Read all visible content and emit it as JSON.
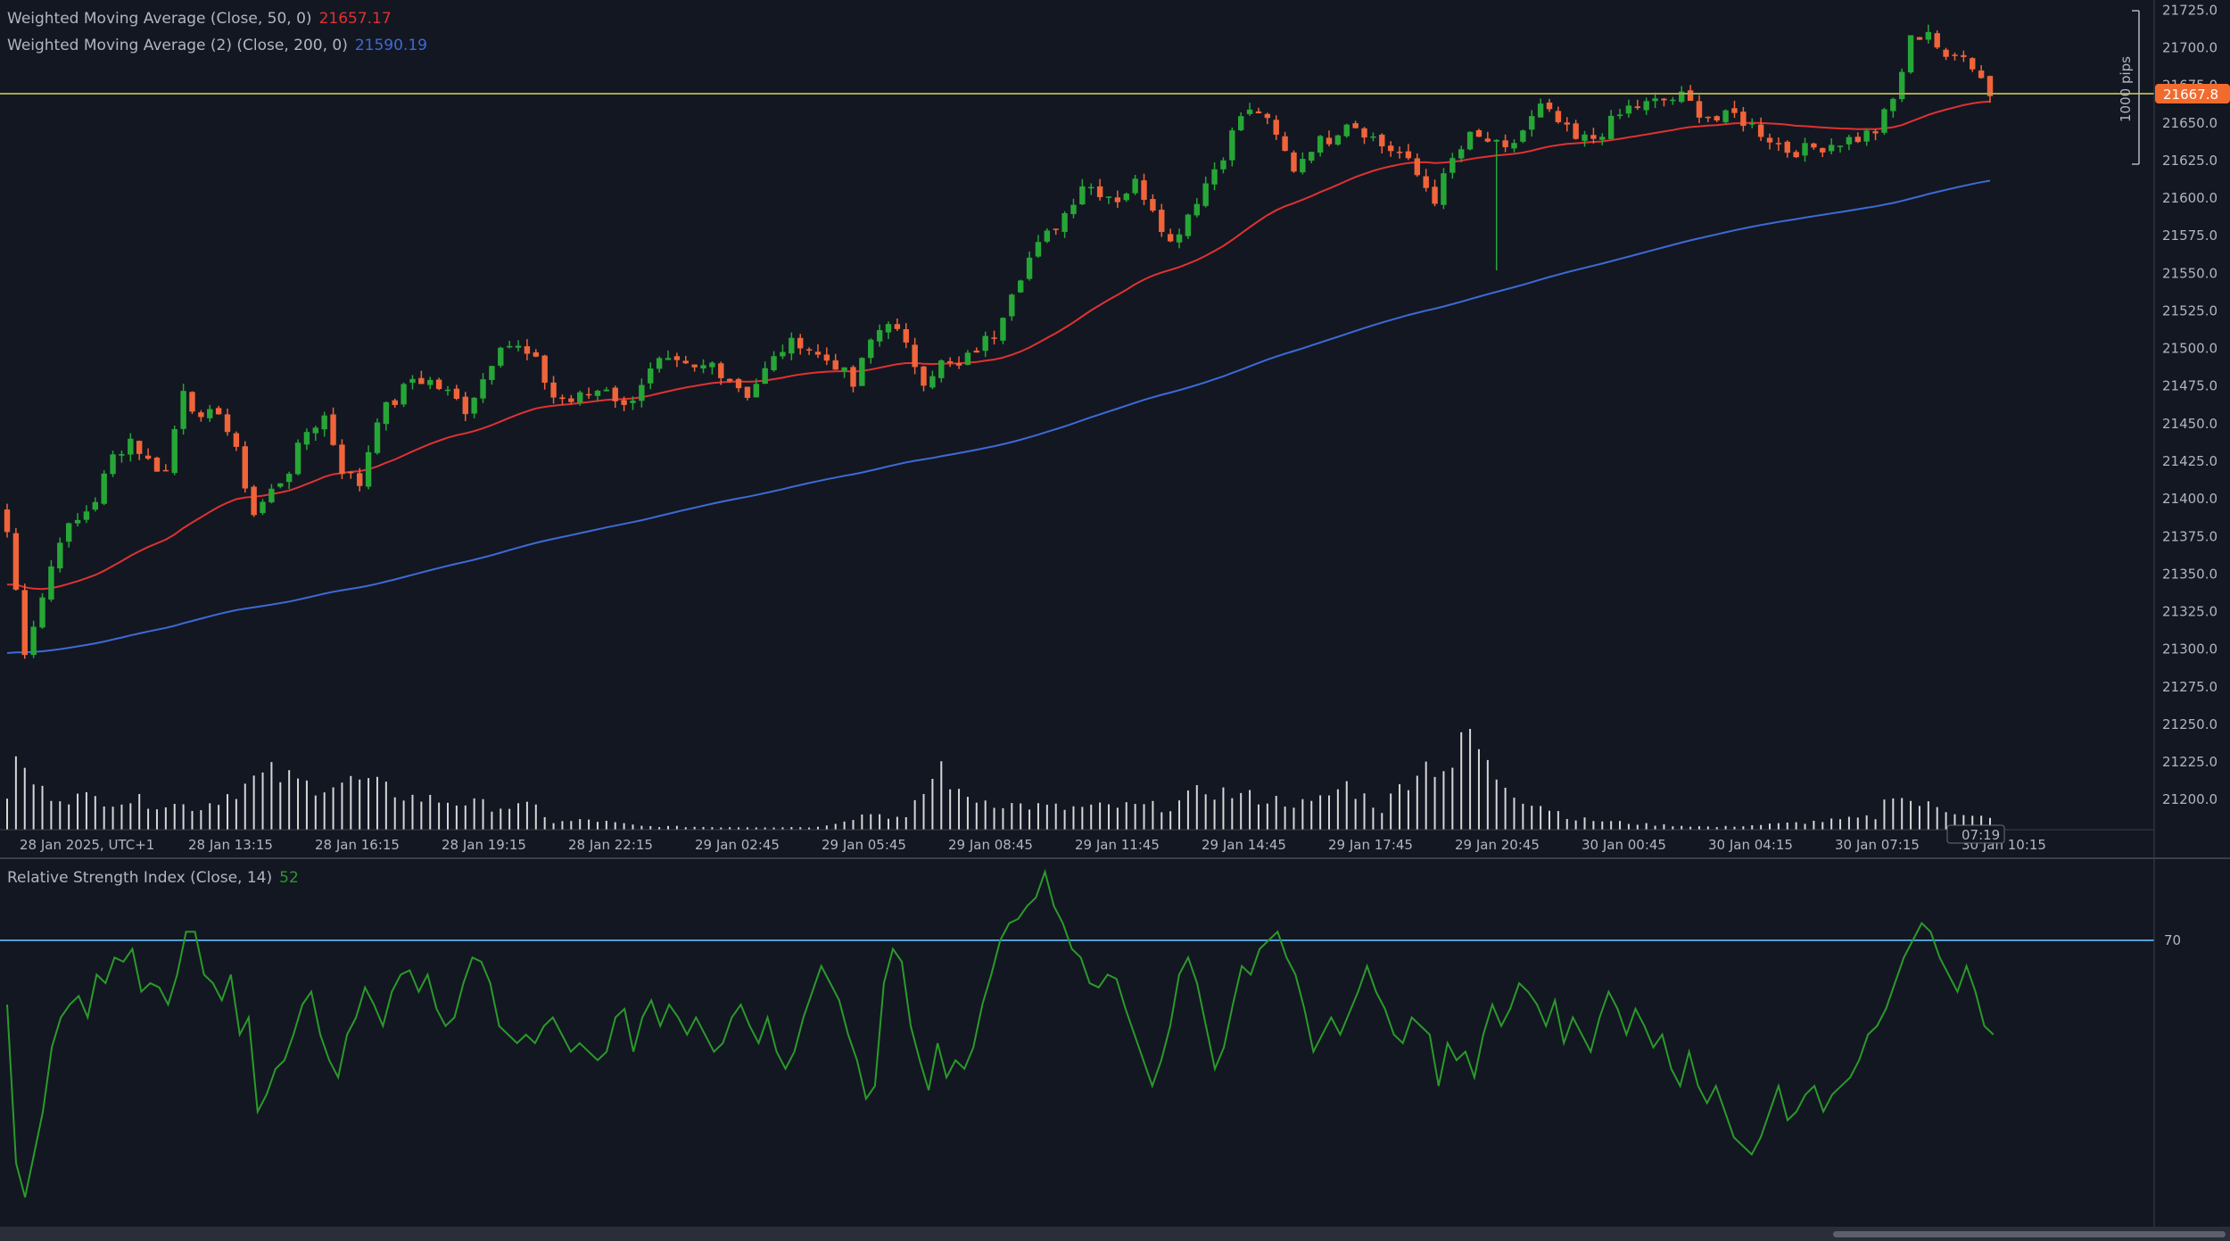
{
  "colors": {
    "background": "#131722",
    "up": "#26a636",
    "down": "#f0643a",
    "wma50": "#e03232",
    "wma200": "#3c6bd6",
    "rsi": "#2a9a2a",
    "price_line": "#a6a84a",
    "rsi_level": "#4f9fd6",
    "volume": "#d6d6d6",
    "axis_text": "#b2b5be",
    "price_tag": "#f26b2e"
  },
  "legend": {
    "wma50_label": "Weighted Moving Average (Close, 50, 0)",
    "wma50_value": "21657.17",
    "wma200_label": "Weighted Moving Average (2) (Close, 200, 0)",
    "wma200_value": "21590.19",
    "rsi_label": "Relative Strength Index (Close, 14)",
    "rsi_value": "52"
  },
  "price_tag": "21667.8",
  "time_tag": "07:19",
  "measure_label": "1000 pips",
  "rsi_level_label": "70",
  "chart_data": {
    "type": "candlestick",
    "y_ticks": [
      "21725.0",
      "21700.0",
      "21675.0",
      "21650.0",
      "21625.0",
      "21600.0",
      "21575.0",
      "21550.0",
      "21525.0",
      "21500.0",
      "21475.0",
      "21450.0",
      "21425.0",
      "21400.0",
      "21375.0",
      "21350.0",
      "21325.0",
      "21300.0",
      "21275.0",
      "21250.0",
      "21225.0",
      "21200.0"
    ],
    "ylim": [
      21193,
      21727
    ],
    "x_labels": [
      "28 Jan 2025, UTC+1",
      "28 Jan 13:15",
      "28 Jan 16:15",
      "28 Jan 19:15",
      "28 Jan 22:15",
      "29 Jan 02:45",
      "29 Jan 05:45",
      "29 Jan 08:45",
      "29 Jan 11:45",
      "29 Jan 14:45",
      "29 Jan 17:45",
      "29 Jan 20:45",
      "30 Jan 00:45",
      "30 Jan 04:15",
      "30 Jan 07:15",
      "30 Jan 10:15"
    ],
    "last_price": 21667.8,
    "rsi_level": 70,
    "close_path": [
      [
        0,
        21378
      ],
      [
        2,
        21300
      ],
      [
        4,
        21335
      ],
      [
        6,
        21375
      ],
      [
        8,
        21385
      ],
      [
        10,
        21400
      ],
      [
        12,
        21428
      ],
      [
        14,
        21440
      ],
      [
        16,
        21425
      ],
      [
        18,
        21418
      ],
      [
        20,
        21475
      ],
      [
        22,
        21450
      ],
      [
        24,
        21460
      ],
      [
        26,
        21430
      ],
      [
        28,
        21390
      ],
      [
        30,
        21405
      ],
      [
        32,
        21420
      ],
      [
        34,
        21445
      ],
      [
        36,
        21455
      ],
      [
        38,
        21420
      ],
      [
        40,
        21410
      ],
      [
        42,
        21455
      ],
      [
        44,
        21465
      ],
      [
        46,
        21480
      ],
      [
        48,
        21478
      ],
      [
        50,
        21470
      ],
      [
        52,
        21460
      ],
      [
        54,
        21480
      ],
      [
        56,
        21505
      ],
      [
        58,
        21500
      ],
      [
        60,
        21490
      ],
      [
        62,
        21468
      ],
      [
        64,
        21465
      ],
      [
        66,
        21470
      ],
      [
        68,
        21475
      ],
      [
        70,
        21460
      ],
      [
        72,
        21478
      ],
      [
        74,
        21490
      ],
      [
        76,
        21488
      ],
      [
        78,
        21485
      ],
      [
        80,
        21490
      ],
      [
        82,
        21480
      ],
      [
        84,
        21470
      ],
      [
        86,
        21485
      ],
      [
        88,
        21500
      ],
      [
        90,
        21505
      ],
      [
        92,
        21495
      ],
      [
        94,
        21490
      ],
      [
        96,
        21475
      ],
      [
        98,
        21505
      ],
      [
        100,
        21520
      ],
      [
        102,
        21500
      ],
      [
        104,
        21480
      ],
      [
        106,
        21490
      ],
      [
        108,
        21487
      ],
      [
        110,
        21500
      ],
      [
        112,
        21510
      ],
      [
        114,
        21540
      ],
      [
        116,
        21560
      ],
      [
        118,
        21575
      ],
      [
        120,
        21590
      ],
      [
        122,
        21610
      ],
      [
        124,
        21605
      ],
      [
        126,
        21600
      ],
      [
        128,
        21610
      ],
      [
        130,
        21595
      ],
      [
        132,
        21570
      ],
      [
        134,
        21590
      ],
      [
        136,
        21610
      ],
      [
        138,
        21630
      ],
      [
        140,
        21655
      ],
      [
        142,
        21658
      ],
      [
        144,
        21640
      ],
      [
        146,
        21620
      ],
      [
        148,
        21635
      ],
      [
        150,
        21640
      ],
      [
        152,
        21652
      ],
      [
        154,
        21645
      ],
      [
        156,
        21635
      ],
      [
        158,
        21630
      ],
      [
        160,
        21615
      ],
      [
        162,
        21600
      ],
      [
        164,
        21625
      ],
      [
        166,
        21640
      ],
      [
        168,
        21638
      ],
      [
        170,
        21630
      ],
      [
        172,
        21645
      ],
      [
        174,
        21660
      ],
      [
        176,
        21650
      ],
      [
        178,
        21638
      ],
      [
        180,
        21640
      ],
      [
        182,
        21650
      ],
      [
        184,
        21660
      ],
      [
        186,
        21662
      ],
      [
        188,
        21665
      ],
      [
        190,
        21667
      ],
      [
        192,
        21658
      ],
      [
        194,
        21652
      ],
      [
        196,
        21655
      ],
      [
        198,
        21648
      ],
      [
        200,
        21640
      ],
      [
        202,
        21632
      ],
      [
        204,
        21632
      ],
      [
        206,
        21635
      ],
      [
        208,
        21638
      ],
      [
        210,
        21640
      ],
      [
        212,
        21645
      ],
      [
        214,
        21665
      ],
      [
        216,
        21705
      ],
      [
        218,
        21712
      ],
      [
        220,
        21690
      ],
      [
        222,
        21698
      ],
      [
        224,
        21680
      ],
      [
        225,
        21667.8
      ]
    ],
    "volume_path": [
      [
        0,
        40
      ],
      [
        1,
        74
      ],
      [
        2,
        65
      ],
      [
        4,
        42
      ],
      [
        8,
        36
      ],
      [
        14,
        33
      ],
      [
        22,
        25
      ],
      [
        28,
        55
      ],
      [
        30,
        62
      ],
      [
        34,
        50
      ],
      [
        40,
        54
      ],
      [
        46,
        36
      ],
      [
        50,
        32
      ],
      [
        56,
        26
      ],
      [
        60,
        25
      ],
      [
        62,
        8
      ],
      [
        66,
        11
      ],
      [
        72,
        4
      ],
      [
        80,
        3
      ],
      [
        92,
        3
      ],
      [
        98,
        19
      ],
      [
        102,
        12
      ],
      [
        106,
        72
      ],
      [
        108,
        38
      ],
      [
        114,
        28
      ],
      [
        120,
        24
      ],
      [
        126,
        26
      ],
      [
        132,
        26
      ],
      [
        136,
        45
      ],
      [
        140,
        38
      ],
      [
        148,
        28
      ],
      [
        152,
        50
      ],
      [
        156,
        23
      ],
      [
        160,
        71
      ],
      [
        162,
        73
      ],
      [
        164,
        72
      ],
      [
        166,
        110
      ],
      [
        168,
        69
      ],
      [
        172,
        36
      ],
      [
        178,
        12
      ],
      [
        186,
        6
      ],
      [
        194,
        3
      ],
      [
        202,
        7
      ],
      [
        208,
        11
      ],
      [
        212,
        14
      ],
      [
        214,
        46
      ],
      [
        216,
        31
      ],
      [
        218,
        27
      ],
      [
        220,
        22
      ],
      [
        222,
        20
      ],
      [
        225,
        12
      ]
    ],
    "rsi_path": [
      [
        0,
        55
      ],
      [
        1,
        18
      ],
      [
        2,
        10
      ],
      [
        3,
        20
      ],
      [
        4,
        30
      ],
      [
        5,
        45
      ],
      [
        6,
        52
      ],
      [
        7,
        55
      ],
      [
        8,
        57
      ],
      [
        9,
        52
      ],
      [
        10,
        62
      ],
      [
        11,
        60
      ],
      [
        12,
        66
      ],
      [
        13,
        65
      ],
      [
        14,
        68
      ],
      [
        15,
        58
      ],
      [
        16,
        60
      ],
      [
        17,
        59
      ],
      [
        18,
        55
      ],
      [
        19,
        62
      ],
      [
        20,
        72
      ],
      [
        21,
        72
      ],
      [
        22,
        62
      ],
      [
        23,
        60
      ],
      [
        24,
        56
      ],
      [
        25,
        62
      ],
      [
        26,
        48
      ],
      [
        27,
        52
      ],
      [
        28,
        30
      ],
      [
        29,
        34
      ],
      [
        30,
        40
      ],
      [
        31,
        42
      ],
      [
        32,
        48
      ],
      [
        33,
        55
      ],
      [
        34,
        58
      ],
      [
        35,
        48
      ],
      [
        36,
        42
      ],
      [
        37,
        38
      ],
      [
        38,
        48
      ],
      [
        39,
        52
      ],
      [
        40,
        59
      ],
      [
        41,
        55
      ],
      [
        42,
        50
      ],
      [
        43,
        58
      ],
      [
        44,
        62
      ],
      [
        45,
        63
      ],
      [
        46,
        58
      ],
      [
        47,
        62
      ],
      [
        48,
        54
      ],
      [
        49,
        50
      ],
      [
        50,
        52
      ],
      [
        51,
        60
      ],
      [
        52,
        66
      ],
      [
        53,
        65
      ],
      [
        54,
        60
      ],
      [
        55,
        50
      ],
      [
        56,
        48
      ],
      [
        57,
        46
      ],
      [
        58,
        48
      ],
      [
        59,
        46
      ],
      [
        60,
        50
      ],
      [
        61,
        52
      ],
      [
        62,
        48
      ],
      [
        63,
        44
      ],
      [
        64,
        46
      ],
      [
        65,
        44
      ],
      [
        66,
        42
      ],
      [
        67,
        44
      ],
      [
        68,
        52
      ],
      [
        69,
        54
      ],
      [
        70,
        44
      ],
      [
        71,
        52
      ],
      [
        72,
        56
      ],
      [
        73,
        50
      ],
      [
        74,
        55
      ],
      [
        75,
        52
      ],
      [
        76,
        48
      ],
      [
        77,
        52
      ],
      [
        78,
        48
      ],
      [
        79,
        44
      ],
      [
        80,
        46
      ],
      [
        81,
        52
      ],
      [
        82,
        55
      ],
      [
        83,
        50
      ],
      [
        84,
        46
      ],
      [
        85,
        52
      ],
      [
        86,
        44
      ],
      [
        87,
        40
      ],
      [
        88,
        44
      ],
      [
        89,
        52
      ],
      [
        90,
        58
      ],
      [
        91,
        64
      ],
      [
        92,
        60
      ],
      [
        93,
        56
      ],
      [
        94,
        48
      ],
      [
        95,
        42
      ],
      [
        96,
        33
      ],
      [
        97,
        36
      ],
      [
        98,
        60
      ],
      [
        99,
        68
      ],
      [
        100,
        65
      ],
      [
        101,
        50
      ],
      [
        102,
        42
      ],
      [
        103,
        35
      ],
      [
        104,
        46
      ],
      [
        105,
        38
      ],
      [
        106,
        42
      ],
      [
        107,
        40
      ],
      [
        108,
        45
      ],
      [
        109,
        55
      ],
      [
        110,
        62
      ],
      [
        111,
        70
      ],
      [
        112,
        74
      ],
      [
        113,
        75
      ],
      [
        114,
        78
      ],
      [
        115,
        80
      ],
      [
        116,
        86
      ],
      [
        117,
        78
      ],
      [
        118,
        74
      ],
      [
        119,
        68
      ],
      [
        120,
        66
      ],
      [
        121,
        60
      ],
      [
        122,
        59
      ],
      [
        123,
        62
      ],
      [
        124,
        61
      ],
      [
        125,
        54
      ],
      [
        126,
        48
      ],
      [
        127,
        42
      ],
      [
        128,
        36
      ],
      [
        129,
        42
      ],
      [
        130,
        50
      ],
      [
        131,
        62
      ],
      [
        132,
        66
      ],
      [
        133,
        60
      ],
      [
        134,
        50
      ],
      [
        135,
        40
      ],
      [
        136,
        45
      ],
      [
        137,
        55
      ],
      [
        138,
        64
      ],
      [
        139,
        62
      ],
      [
        140,
        68
      ],
      [
        141,
        70
      ],
      [
        142,
        72
      ],
      [
        143,
        66
      ],
      [
        144,
        62
      ],
      [
        145,
        54
      ],
      [
        146,
        44
      ],
      [
        147,
        48
      ],
      [
        148,
        52
      ],
      [
        149,
        48
      ],
      [
        150,
        53
      ],
      [
        151,
        58
      ],
      [
        152,
        64
      ],
      [
        153,
        58
      ],
      [
        154,
        54
      ],
      [
        155,
        48
      ],
      [
        156,
        46
      ],
      [
        157,
        52
      ],
      [
        158,
        50
      ],
      [
        159,
        48
      ],
      [
        160,
        36
      ],
      [
        161,
        46
      ],
      [
        162,
        42
      ],
      [
        163,
        44
      ],
      [
        164,
        38
      ],
      [
        165,
        48
      ],
      [
        166,
        55
      ],
      [
        167,
        50
      ],
      [
        168,
        54
      ],
      [
        169,
        60
      ],
      [
        170,
        58
      ],
      [
        171,
        55
      ],
      [
        172,
        50
      ],
      [
        173,
        56
      ],
      [
        174,
        46
      ],
      [
        175,
        52
      ],
      [
        176,
        48
      ],
      [
        177,
        44
      ],
      [
        178,
        52
      ],
      [
        179,
        58
      ],
      [
        180,
        54
      ],
      [
        181,
        48
      ],
      [
        182,
        54
      ],
      [
        183,
        50
      ],
      [
        184,
        45
      ],
      [
        185,
        48
      ],
      [
        186,
        40
      ],
      [
        187,
        36
      ],
      [
        188,
        44
      ],
      [
        189,
        36
      ],
      [
        190,
        32
      ],
      [
        191,
        36
      ],
      [
        192,
        30
      ],
      [
        193,
        24
      ],
      [
        194,
        22
      ],
      [
        195,
        20
      ],
      [
        196,
        24
      ],
      [
        197,
        30
      ],
      [
        198,
        36
      ],
      [
        199,
        28
      ],
      [
        200,
        30
      ],
      [
        201,
        34
      ],
      [
        202,
        36
      ],
      [
        203,
        30
      ],
      [
        204,
        34
      ],
      [
        205,
        36
      ],
      [
        206,
        38
      ],
      [
        207,
        42
      ],
      [
        208,
        48
      ],
      [
        209,
        50
      ],
      [
        210,
        54
      ],
      [
        211,
        60
      ],
      [
        212,
        66
      ],
      [
        213,
        70
      ],
      [
        214,
        74
      ],
      [
        215,
        72
      ],
      [
        216,
        66
      ],
      [
        217,
        62
      ],
      [
        218,
        58
      ],
      [
        219,
        64
      ],
      [
        220,
        58
      ],
      [
        221,
        50
      ],
      [
        222,
        48
      ]
    ]
  }
}
